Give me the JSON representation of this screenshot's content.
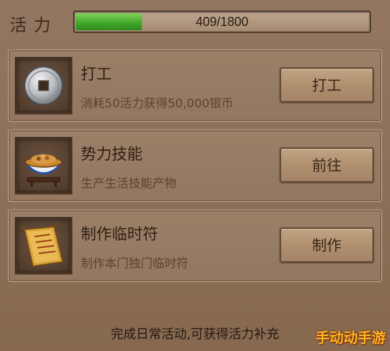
{
  "vitality": {
    "label": "活力",
    "current": 409,
    "max": 1800,
    "display": "409/1800",
    "fill_fraction": 0.227,
    "fill_color": "#45a82b"
  },
  "tasks": [
    {
      "title": "打工",
      "desc": "消耗50活力获得50,000银币",
      "icon": "silver-coin-icon",
      "button": "打工"
    },
    {
      "title": "势力技能",
      "desc": "生产生活技能产物",
      "icon": "food-bowl-icon",
      "button": "前往"
    },
    {
      "title": "制作临时符",
      "desc": "制作本门独门临时符",
      "icon": "talisman-scroll-icon",
      "button": "制作"
    }
  ],
  "footer": "完成日常活动,可获得活力补充",
  "watermark": "手动动手游"
}
